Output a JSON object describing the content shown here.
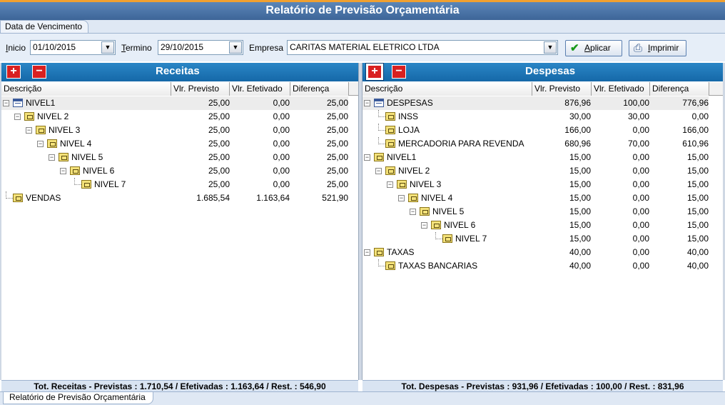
{
  "window": {
    "title": "Relatório de Previsão Orçamentária"
  },
  "top_tab": "Data de Vencimento",
  "filters": {
    "inicio_label_u": "I",
    "inicio_label_rest": "nicio",
    "inicio_value": "01/10/2015",
    "termino_label_u": "T",
    "termino_label_rest": "ermino",
    "termino_value": "29/10/2015",
    "empresa_label": "Empresa",
    "empresa_value": "CARITAS MATERIAL ELETRICO LTDA",
    "aplicar_u": "A",
    "aplicar_rest": "plicar",
    "imprimir_u": "I",
    "imprimir_rest": "mprimir"
  },
  "columns": {
    "descricao": "Descrição",
    "previsto": "Vlr. Previsto",
    "efetivado": "Vlr. Efetivado",
    "diferenca": "Diferença"
  },
  "receitas": {
    "title": "Receitas",
    "rows": [
      {
        "desc": "NIVEL1",
        "previsto": "25,00",
        "efetivado": "0,00",
        "diferenca": "25,00"
      },
      {
        "desc": "NIVEL 2",
        "previsto": "25,00",
        "efetivado": "0,00",
        "diferenca": "25,00"
      },
      {
        "desc": "NIVEL 3",
        "previsto": "25,00",
        "efetivado": "0,00",
        "diferenca": "25,00"
      },
      {
        "desc": "NIVEL 4",
        "previsto": "25,00",
        "efetivado": "0,00",
        "diferenca": "25,00"
      },
      {
        "desc": "NIVEL 5",
        "previsto": "25,00",
        "efetivado": "0,00",
        "diferenca": "25,00"
      },
      {
        "desc": "NIVEL 6",
        "previsto": "25,00",
        "efetivado": "0,00",
        "diferenca": "25,00"
      },
      {
        "desc": "NIVEL 7",
        "previsto": "25,00",
        "efetivado": "0,00",
        "diferenca": "25,00"
      },
      {
        "desc": "VENDAS",
        "previsto": "1.685,54",
        "efetivado": "1.163,64",
        "diferenca": "521,90"
      }
    ],
    "total": "Tot. Receitas - Previstas : 1.710,54 / Efetivadas : 1.163,64 / Rest. : 546,90"
  },
  "despesas": {
    "title": "Despesas",
    "rows": [
      {
        "desc": "DESPESAS",
        "previsto": "876,96",
        "efetivado": "100,00",
        "diferenca": "776,96"
      },
      {
        "desc": "INSS",
        "previsto": "30,00",
        "efetivado": "30,00",
        "diferenca": "0,00"
      },
      {
        "desc": "LOJA",
        "previsto": "166,00",
        "efetivado": "0,00",
        "diferenca": "166,00"
      },
      {
        "desc": "MERCADORIA PARA REVENDA",
        "previsto": "680,96",
        "efetivado": "70,00",
        "diferenca": "610,96"
      },
      {
        "desc": "NIVEL1",
        "previsto": "15,00",
        "efetivado": "0,00",
        "diferenca": "15,00"
      },
      {
        "desc": "NIVEL 2",
        "previsto": "15,00",
        "efetivado": "0,00",
        "diferenca": "15,00"
      },
      {
        "desc": "NIVEL 3",
        "previsto": "15,00",
        "efetivado": "0,00",
        "diferenca": "15,00"
      },
      {
        "desc": "NIVEL 4",
        "previsto": "15,00",
        "efetivado": "0,00",
        "diferenca": "15,00"
      },
      {
        "desc": "NIVEL 5",
        "previsto": "15,00",
        "efetivado": "0,00",
        "diferenca": "15,00"
      },
      {
        "desc": "NIVEL 6",
        "previsto": "15,00",
        "efetivado": "0,00",
        "diferenca": "15,00"
      },
      {
        "desc": "NIVEL 7",
        "previsto": "15,00",
        "efetivado": "0,00",
        "diferenca": "15,00"
      },
      {
        "desc": "TAXAS",
        "previsto": "40,00",
        "efetivado": "0,00",
        "diferenca": "40,00"
      },
      {
        "desc": "TAXAS BANCARIAS",
        "previsto": "40,00",
        "efetivado": "0,00",
        "diferenca": "40,00"
      }
    ],
    "total": "Tot. Despesas - Previstas : 931,96 / Efetivadas : 100,00 / Rest. : 831,96"
  },
  "icons": {
    "plus": "plus-icon",
    "minus": "minus-icon",
    "check": "check-icon",
    "printer": "printer-icon",
    "folder": "folder-icon",
    "table": "table-icon"
  },
  "bottom_tab": "Relatório de Previsão Orçamentária"
}
